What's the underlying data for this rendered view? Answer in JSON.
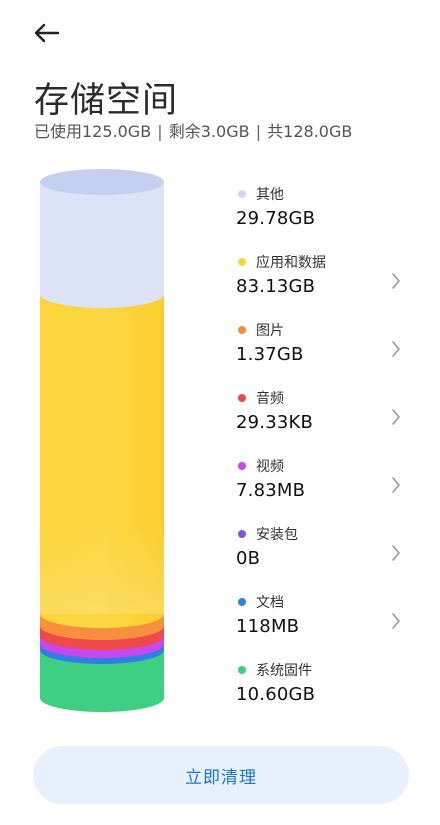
{
  "header": {
    "back_icon": "back-arrow-icon"
  },
  "title": "存储空间",
  "summary": {
    "used": "已使用125.0GB",
    "free": "剩余3.0GB",
    "total": "共128.0GB",
    "separator": "|"
  },
  "categories": [
    {
      "label": "其他",
      "value": "29.78GB",
      "color": "#cfd8f3",
      "has_arrow": false
    },
    {
      "label": "应用和数据",
      "value": "83.13GB",
      "color": "#fcd53a",
      "has_arrow": true
    },
    {
      "label": "图片",
      "value": "1.37GB",
      "color": "#f6903d",
      "has_arrow": true
    },
    {
      "label": "音频",
      "value": "29.33KB",
      "color": "#ee4a4a",
      "has_arrow": true
    },
    {
      "label": "视频",
      "value": "7.83MB",
      "color": "#c648ee",
      "has_arrow": true
    },
    {
      "label": "安装包",
      "value": "0B",
      "color": "#8a4ee6",
      "has_arrow": true
    },
    {
      "label": "文档",
      "value": "118MB",
      "color": "#2f7fe6",
      "has_arrow": true
    },
    {
      "label": "系统固件",
      "value": "10.60GB",
      "color": "#3ecf82",
      "has_arrow": false
    }
  ],
  "clean_button": "立即清理"
}
